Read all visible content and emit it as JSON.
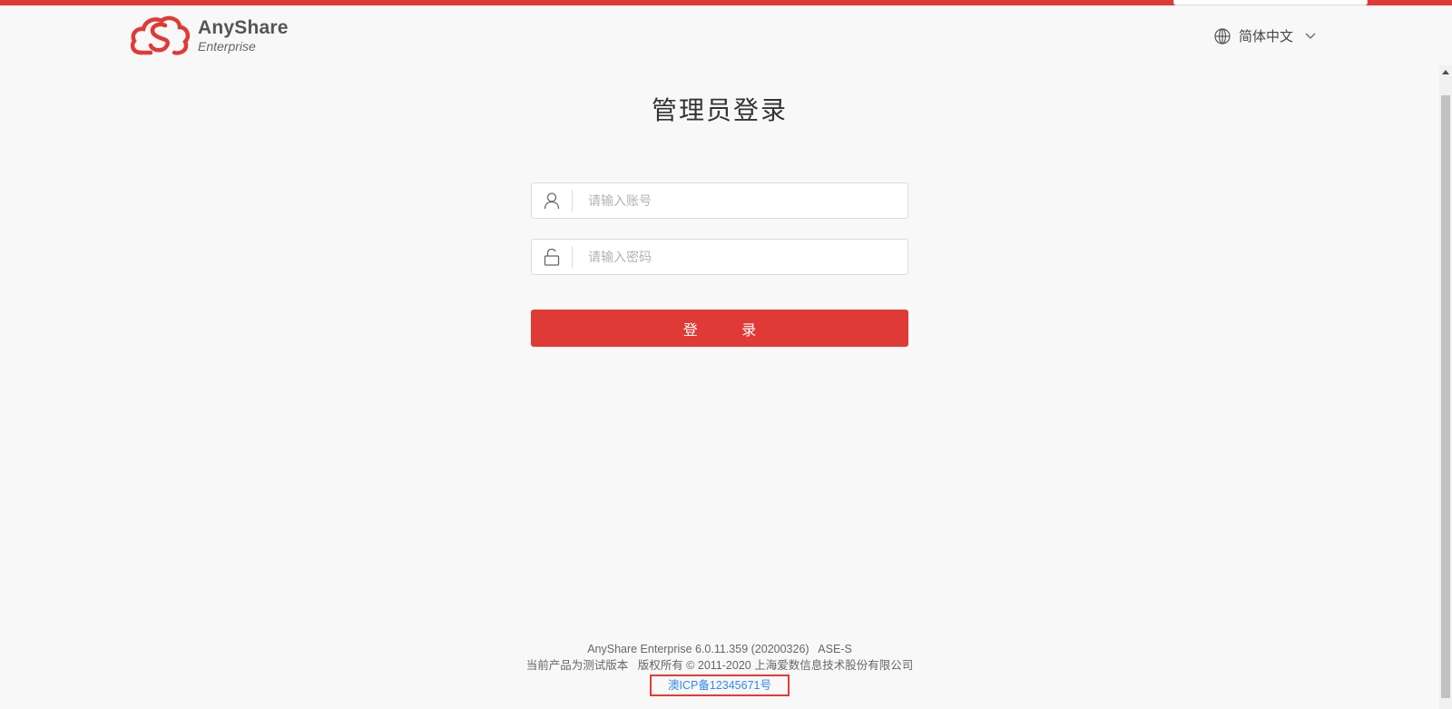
{
  "brand": {
    "name": "AnyShare",
    "edition": "Enterprise",
    "primary_color": "#e03a36"
  },
  "header": {
    "language": "简体中文",
    "language_icon": "globe-icon",
    "dropdown_icon": "chevron-down-icon"
  },
  "login": {
    "title": "管理员登录",
    "account_placeholder": "请输入账号",
    "account_icon": "user-icon",
    "password_placeholder": "请输入密码",
    "password_icon": "lock-icon",
    "submit_label": "登 录"
  },
  "footer": {
    "version": "AnyShare Enterprise 6.0.11.359 (20200326)   ASE-S",
    "copyright": "当前产品为测试版本   版权所有 © 2011-2020 上海爱数信息技术股份有限公司",
    "icp": "澳ICP备12345671号",
    "icp_color": "#2d8cf0"
  }
}
